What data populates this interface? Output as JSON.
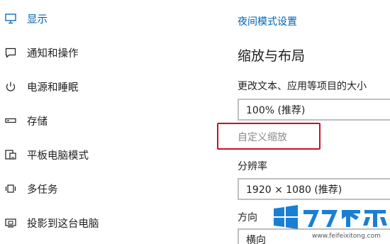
{
  "sidebar": {
    "items": [
      {
        "label": "显示",
        "icon": "monitor-icon",
        "active": true
      },
      {
        "label": "通知和操作",
        "icon": "notification-icon",
        "active": false
      },
      {
        "label": "电源和睡眠",
        "icon": "power-icon",
        "active": false
      },
      {
        "label": "存储",
        "icon": "storage-icon",
        "active": false
      },
      {
        "label": "平板电脑模式",
        "icon": "tablet-mode-icon",
        "active": false
      },
      {
        "label": "多任务",
        "icon": "multitask-icon",
        "active": false
      },
      {
        "label": "投影到这台电脑",
        "icon": "projector-icon",
        "active": false
      }
    ]
  },
  "main": {
    "night_mode_link": "夜间模式设置",
    "section_title": "缩放与布局",
    "scale_label": "更改文本、应用等项目的大小",
    "scale_value": "100% (推荐)",
    "custom_scale_link": "自定义缩放",
    "resolution_label": "分辨率",
    "resolution_value": "1920 × 1080 (推荐)",
    "orientation_label": "方向",
    "orientation_value": "横向"
  },
  "watermark": {
    "url": "www.feifeixitong.com"
  },
  "colors": {
    "accent": "#0063b1",
    "highlight": "#c8102e",
    "muted_text": "#8a8a8a",
    "brand": "#1a7fd4"
  }
}
